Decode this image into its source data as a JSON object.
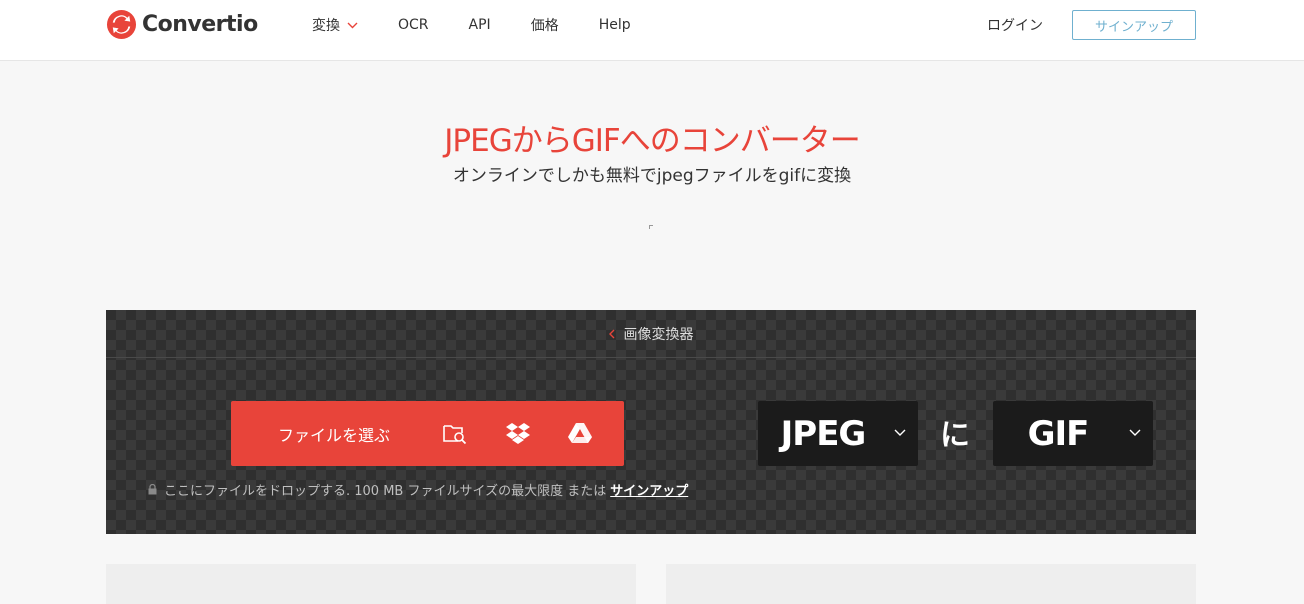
{
  "brand": {
    "name": "Convertio",
    "accent": "#e8443a"
  },
  "nav": {
    "items": [
      {
        "label": "変換",
        "has_dropdown": true
      },
      {
        "label": "OCR"
      },
      {
        "label": "API"
      },
      {
        "label": "価格"
      },
      {
        "label": "Help"
      }
    ],
    "login": "ログイン",
    "signup": "サインアップ"
  },
  "hero": {
    "title": "JPEGからGIFへのコンバーター",
    "subtitle": "オンラインでしかも無料でjpegファイルをgifに変換"
  },
  "converter": {
    "breadcrumb": "画像変換器",
    "choose_files": "ファイルを選ぶ",
    "source_icons": [
      "folder-search-icon",
      "dropbox-icon",
      "google-drive-icon"
    ],
    "drop_note": "ここにファイルをドロップする. 100 MB ファイルサイズの最大限度 または",
    "drop_note_link": "サインアップ",
    "from_format": "JPEG",
    "to_word": "に",
    "to_format": "GIF"
  }
}
